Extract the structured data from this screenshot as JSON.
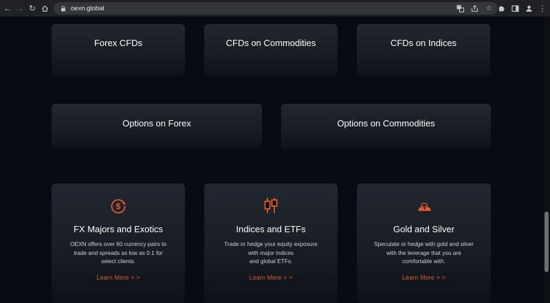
{
  "browser": {
    "url": "oexn.global",
    "icons": {
      "back": "arrow-left-icon",
      "forward": "arrow-right-icon",
      "reload": "reload-icon",
      "home": "home-icon",
      "lock": "lock-icon",
      "translate": "translate-icon",
      "share": "share-icon",
      "bookmark": "star-icon",
      "extensions": "puzzle-icon",
      "sidepanel": "side-panel-icon",
      "profile": "profile-icon",
      "menu": "kebab-menu-icon"
    }
  },
  "categories_row1": [
    {
      "label": "Forex CFDs"
    },
    {
      "label": "CFDs on Commodities"
    },
    {
      "label": "CFDs on Indices"
    }
  ],
  "categories_row2": [
    {
      "label": "Options on Forex"
    },
    {
      "label": "Options on Commodities"
    }
  ],
  "features": [
    {
      "icon": "currency-exchange-icon",
      "title": "FX Majors and Exotics",
      "desc_lines": [
        "OEXN offers over 60 currency pairs to",
        "trade and spreads as low as 0.1 for",
        "select clients."
      ],
      "link": "Learn More  >  >"
    },
    {
      "icon": "candlestick-chart-icon",
      "title": "Indices and ETFs",
      "desc_lines": [
        "Trade or hedge your equity exposure",
        "with major indices",
        "and global ETFs."
      ],
      "link": "Learn More  >  >"
    },
    {
      "icon": "gold-bars-icon",
      "title": "Gold and Silver",
      "desc_lines": [
        "Speculate or hedge with gold and silver",
        "with the leverage that you are",
        "comfortable with."
      ],
      "link": "Learn More  >  >"
    }
  ],
  "colors": {
    "accent": "#e35a2b",
    "background": "#070b13",
    "card": "#1f232b"
  }
}
